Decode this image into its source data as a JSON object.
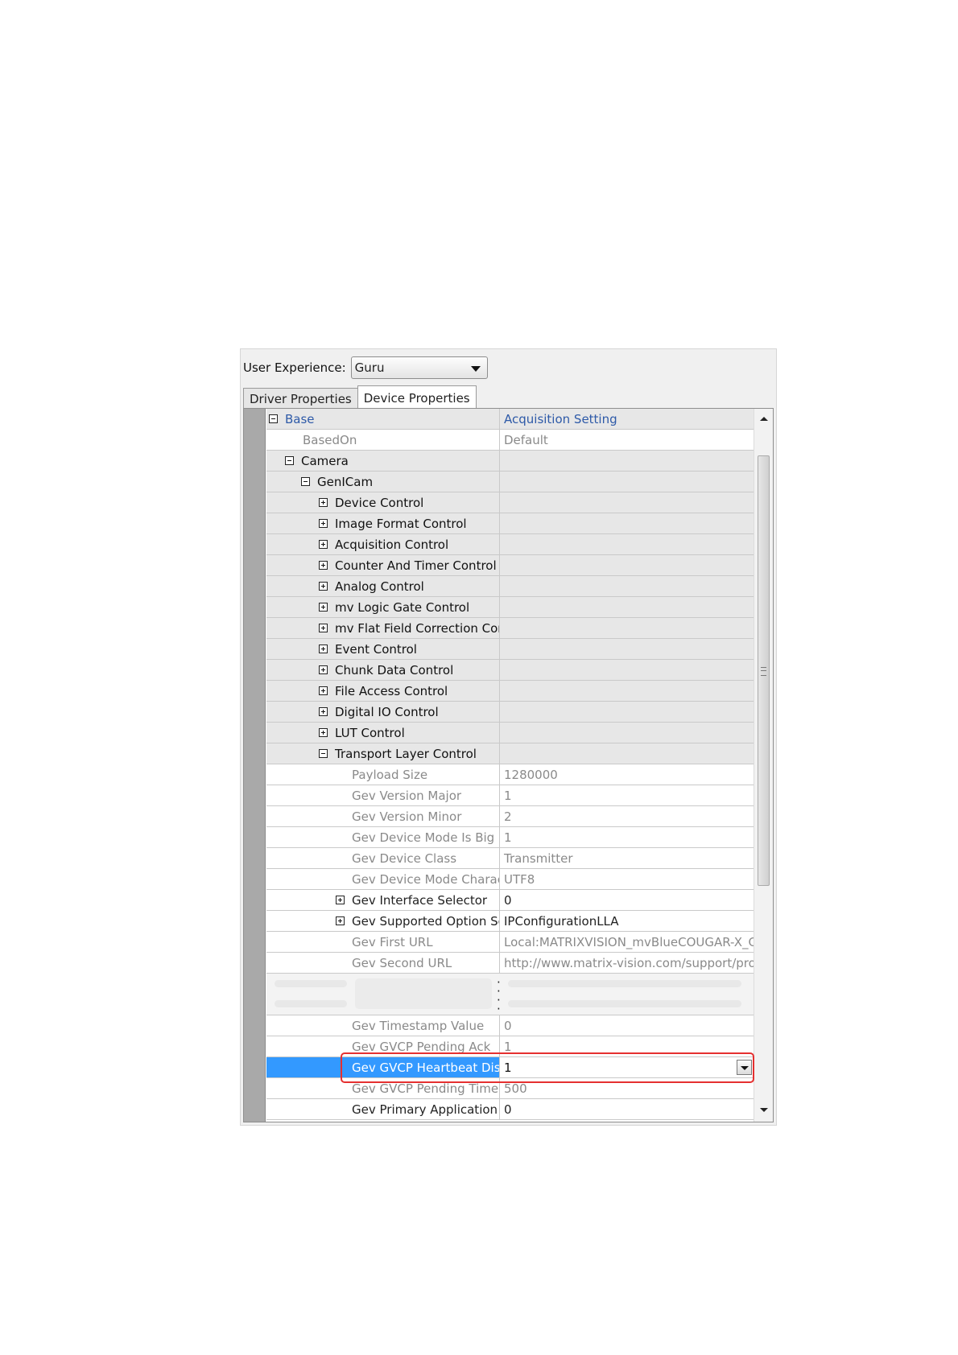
{
  "user_experience": {
    "label": "User Experience:",
    "selected": "Guru"
  },
  "tabs": [
    {
      "label": "Driver Properties",
      "active": false
    },
    {
      "label": "Device Properties",
      "active": true
    }
  ],
  "grid": {
    "header": {
      "name": "Base",
      "value": "Acquisition Setting"
    },
    "rows": [
      {
        "name": "BasedOn",
        "value": "Default"
      },
      {
        "name": "Camera",
        "value": ""
      },
      {
        "name": "GenICam",
        "value": ""
      },
      {
        "name": "Device Control",
        "value": ""
      },
      {
        "name": "Image Format Control",
        "value": ""
      },
      {
        "name": "Acquisition Control",
        "value": ""
      },
      {
        "name": "Counter And Timer Control",
        "value": ""
      },
      {
        "name": "Analog Control",
        "value": ""
      },
      {
        "name": "mv Logic Gate Control",
        "value": ""
      },
      {
        "name": "mv Flat Field Correction Cont",
        "value": ""
      },
      {
        "name": "Event Control",
        "value": ""
      },
      {
        "name": "Chunk Data Control",
        "value": ""
      },
      {
        "name": "File Access Control",
        "value": ""
      },
      {
        "name": "Digital IO Control",
        "value": ""
      },
      {
        "name": "LUT Control",
        "value": ""
      },
      {
        "name": "Transport Layer Control",
        "value": ""
      },
      {
        "name": "Payload Size",
        "value": "1280000"
      },
      {
        "name": "Gev Version Major",
        "value": "1"
      },
      {
        "name": "Gev Version Minor",
        "value": "2"
      },
      {
        "name": "Gev Device Mode Is Big Er",
        "value": "1"
      },
      {
        "name": "Gev Device Class",
        "value": "Transmitter"
      },
      {
        "name": "Gev Device Mode Charact",
        "value": "UTF8"
      },
      {
        "name": "Gev Interface Selector",
        "value": "0"
      },
      {
        "name": "Gev Supported Option Se",
        "value": "IPConfigurationLLA"
      },
      {
        "name": "Gev First URL",
        "value": "Local:MATRIXVISION_mvBlueCOUGAR-X_Gig"
      },
      {
        "name": "Gev Second URL",
        "value": "http://www.matrix-vision.com/support/produ"
      },
      {
        "name": "Gev Timestamp Value",
        "value": "0"
      },
      {
        "name": "Gev GVCP Pending Ack",
        "value": "1"
      },
      {
        "name": "Gev GVCP Heartbeat Disa",
        "value": "1"
      },
      {
        "name": "Gev GVCP Pending Timeoı",
        "value": "500"
      },
      {
        "name": "Gev Primary Application S",
        "value": "0"
      }
    ]
  },
  "colors": {
    "selection": "#3399ff",
    "header_text": "#2e5aa8",
    "highlight_box": "#e53030"
  }
}
